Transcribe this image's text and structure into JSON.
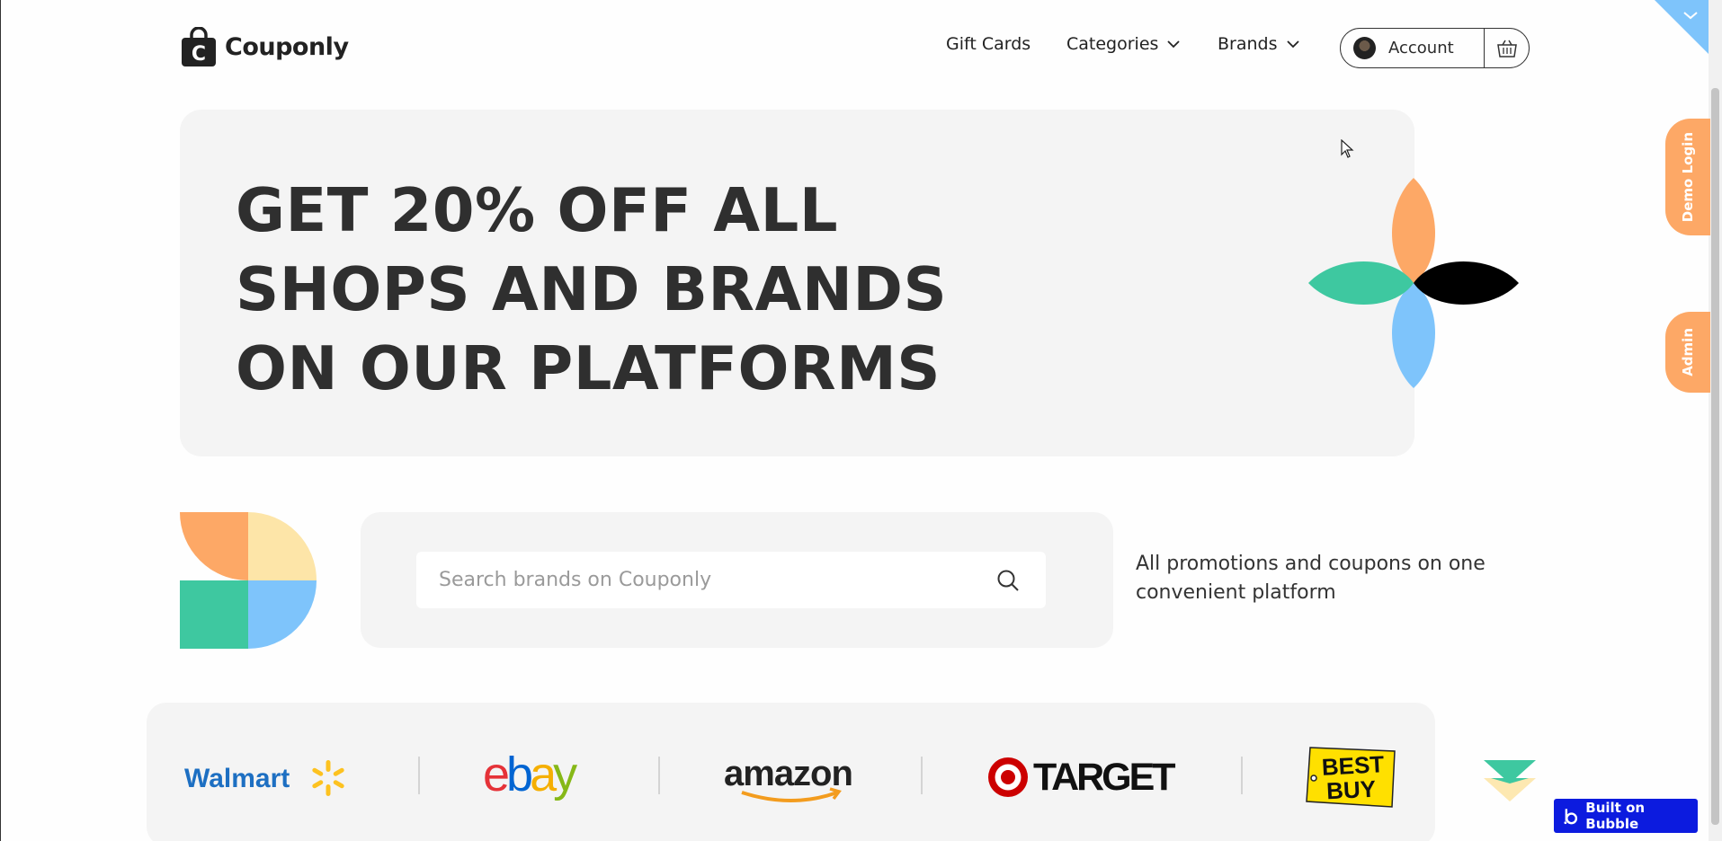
{
  "header": {
    "brand_name": "Couponly",
    "nav": {
      "gift_cards": "Gift Cards",
      "categories": "Categories",
      "brands": "Brands"
    },
    "account_label": "Account"
  },
  "side_tabs": {
    "demo_login": "Demo Login",
    "admin": "Admin"
  },
  "hero": {
    "title": "GET 20% OFF ALL SHOPS AND BRANDS ON OUR PLATFORMS"
  },
  "search": {
    "placeholder": "Search brands on Couponly",
    "tagline": "All promotions and coupons on one convenient platform"
  },
  "brand_logos": [
    "Walmart",
    "ebay",
    "amazon",
    "TARGET",
    "BEST BUY"
  ],
  "badge": {
    "label": "Built on Bubble"
  },
  "colors": {
    "orange": "#fda866",
    "green": "#3ec8a0",
    "blue": "#7ec4fb",
    "yellow": "#fde5a8",
    "dark": "#2f2f2f",
    "bubble_blue": "#0c1bdf"
  }
}
